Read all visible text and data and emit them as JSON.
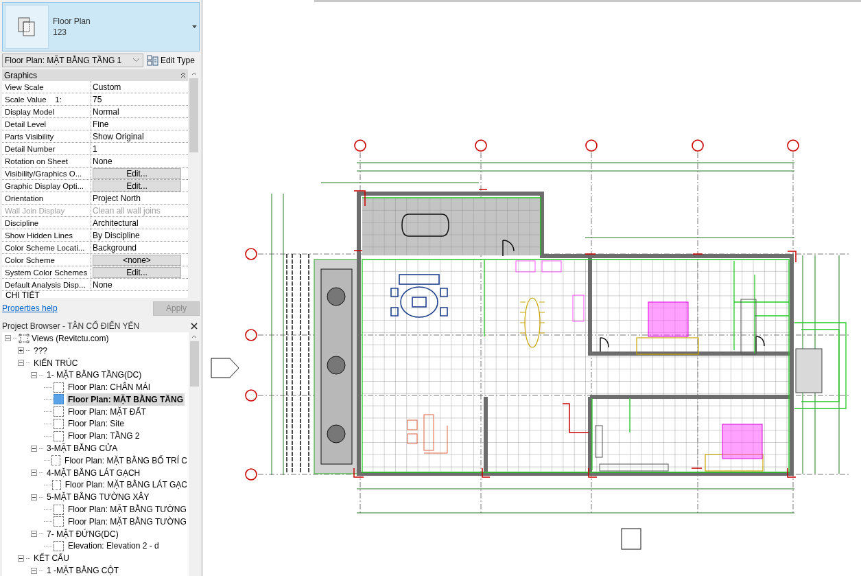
{
  "type_selector": {
    "family": "Floor Plan",
    "type": "123"
  },
  "instance_dropdown": {
    "value": "Floor Plan: MẶT BẰNG TẦNG 1"
  },
  "edit_type_button": "Edit Type",
  "properties": {
    "group": "Graphics",
    "rows": [
      {
        "name": "View Scale",
        "value": "Custom",
        "kind": "text",
        "disabled": false
      },
      {
        "name": "Scale Value    1:",
        "value": "75",
        "kind": "text",
        "disabled": false
      },
      {
        "name": "Display Model",
        "value": "Normal",
        "kind": "text",
        "disabled": false
      },
      {
        "name": "Detail Level",
        "value": "Fine",
        "kind": "text",
        "disabled": false
      },
      {
        "name": "Parts Visibility",
        "value": "Show Original",
        "kind": "text",
        "disabled": false
      },
      {
        "name": "Detail Number",
        "value": "1",
        "kind": "text",
        "disabled": false
      },
      {
        "name": "Rotation on Sheet",
        "value": "None",
        "kind": "text",
        "disabled": false
      },
      {
        "name": "Visibility/Graphics O...",
        "value": "Edit...",
        "kind": "button",
        "disabled": false
      },
      {
        "name": "Graphic Display Opti...",
        "value": "Edit...",
        "kind": "button",
        "disabled": false
      },
      {
        "name": "Orientation",
        "value": "Project North",
        "kind": "text",
        "disabled": false
      },
      {
        "name": "Wall Join Display",
        "value": "Clean all wall joins",
        "kind": "text",
        "disabled": true
      },
      {
        "name": "Discipline",
        "value": "Architectural",
        "kind": "text",
        "disabled": false
      },
      {
        "name": "Show Hidden Lines",
        "value": "By Discipline",
        "kind": "text",
        "disabled": false
      },
      {
        "name": "Color Scheme Locati...",
        "value": "Background",
        "kind": "text",
        "disabled": false
      },
      {
        "name": "Color Scheme",
        "value": "<none>",
        "kind": "button",
        "disabled": false
      },
      {
        "name": "System Color Schemes",
        "value": "Edit...",
        "kind": "button",
        "disabled": false
      },
      {
        "name": "Default Analysis Disp...",
        "value": "None",
        "kind": "text",
        "disabled": false
      }
    ],
    "next_group": "CHI TIẾT"
  },
  "properties_help": "Properties help",
  "apply_button": {
    "label": "Apply",
    "disabled": true
  },
  "project_browser": {
    "title": "Project Browser - TÂN CỔ ĐIỂN YẾN",
    "tree": [
      {
        "label": "Views (Revitctu.com)",
        "kind": "root",
        "expanded": true,
        "children": [
          {
            "label": "???",
            "kind": "folder",
            "expanded": false
          },
          {
            "label": "KIẾN TRÚC",
            "kind": "folder",
            "expanded": true,
            "children": [
              {
                "label": "1- MẶT BẰNG TẦNG(DC)",
                "kind": "folder",
                "expanded": true,
                "children": [
                  {
                    "label": "Floor Plan: CHÂN MÁI",
                    "kind": "view",
                    "selected": false
                  },
                  {
                    "label": "Floor Plan: MẶT BẰNG TẦNG",
                    "kind": "view",
                    "selected": true
                  },
                  {
                    "label": "Floor Plan: MẶT ĐẤT",
                    "kind": "view",
                    "selected": false
                  },
                  {
                    "label": "Floor Plan: Site",
                    "kind": "view",
                    "selected": false
                  },
                  {
                    "label": "Floor Plan: TẦNG 2",
                    "kind": "view",
                    "selected": false
                  }
                ]
              },
              {
                "label": "3-MẶT BẰNG CỬA",
                "kind": "folder",
                "expanded": true,
                "children": [
                  {
                    "label": "Floor Plan: MẶT BẰNG BỐ TRÍ C",
                    "kind": "view",
                    "selected": false
                  }
                ]
              },
              {
                "label": "4-MẶT BẰNG LÁT GẠCH",
                "kind": "folder",
                "expanded": true,
                "children": [
                  {
                    "label": "Floor Plan: MẶT BẰNG LÁT GẠC",
                    "kind": "view",
                    "selected": false
                  }
                ]
              },
              {
                "label": "5-MẶT BẰNG TƯỜNG XÂY",
                "kind": "folder",
                "expanded": true,
                "children": [
                  {
                    "label": "Floor Plan: MẶT BẰNG TƯỜNG",
                    "kind": "view",
                    "selected": false
                  },
                  {
                    "label": "Floor Plan: MẶT BẰNG TƯỜNG",
                    "kind": "view",
                    "selected": false
                  }
                ]
              },
              {
                "label": "7- MẶT ĐỨNG(DC)",
                "kind": "folder",
                "expanded": true,
                "children": [
                  {
                    "label": "Elevation: Elevation 2 - d",
                    "kind": "view",
                    "selected": false
                  }
                ]
              }
            ]
          },
          {
            "label": "KẾT CẤU",
            "kind": "folder",
            "expanded": true,
            "children": [
              {
                "label": "1 -MẶT BẰNG CỘT",
                "kind": "folder",
                "expanded": true
              }
            ]
          }
        ]
      }
    ]
  }
}
